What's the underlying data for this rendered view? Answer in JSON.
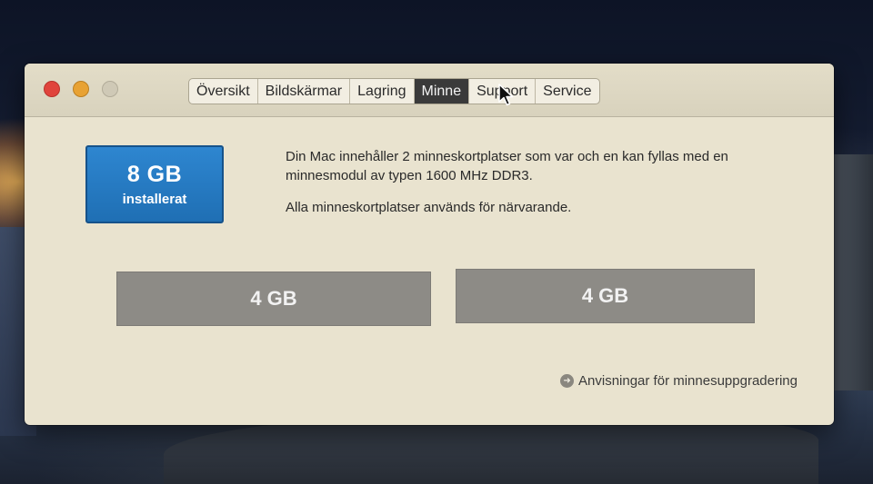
{
  "window": {
    "tabs": [
      {
        "label": "Översikt",
        "active": false
      },
      {
        "label": "Bildskärmar",
        "active": false
      },
      {
        "label": "Lagring",
        "active": false
      },
      {
        "label": "Minne",
        "active": true
      },
      {
        "label": "Support",
        "active": false
      },
      {
        "label": "Service",
        "active": false
      }
    ]
  },
  "memory": {
    "installed_size": "8 GB",
    "installed_label": "installerat",
    "description": "Din Mac innehåller 2 minneskortplatser som var och en kan fyllas med en minnesmodul av typen 1600 MHz DDR3.",
    "slots_note": "Alla minneskortplatser används för närvarande.",
    "slots": [
      {
        "label": "4 GB"
      },
      {
        "label": "4 GB"
      }
    ],
    "upgrade_link": "Anvisningar för minnesuppgradering"
  },
  "colors": {
    "badge_blue": "#2378c2",
    "slot_gray": "#8d8b86",
    "window_bg": "#e9e3cf",
    "close_red": "#e0443c",
    "minimize_orange": "#e8a233"
  },
  "icons": {
    "upgrade_link_icon": "arrow-circle-icon",
    "pointer": "mouse-cursor-icon"
  }
}
